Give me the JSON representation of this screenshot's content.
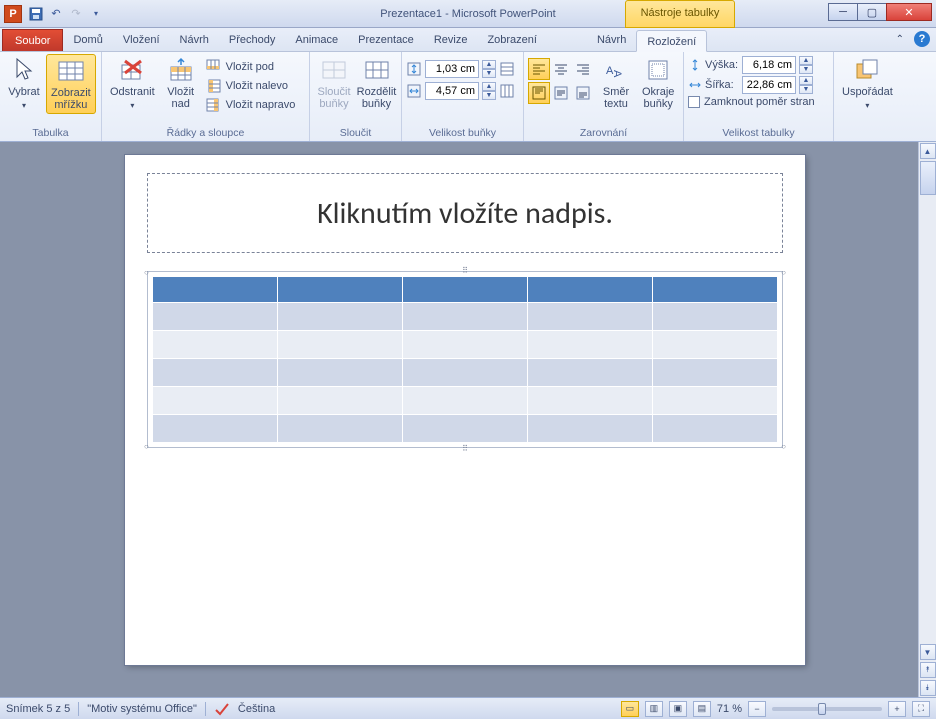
{
  "title": "Prezentace1  -  Microsoft PowerPoint",
  "context_tab": "Nástroje tabulky",
  "file_tab": "Soubor",
  "tabs": [
    "Domů",
    "Vložení",
    "Návrh",
    "Přechody",
    "Animace",
    "Prezentace",
    "Revize",
    "Zobrazení",
    "Návrh",
    "Rozložení"
  ],
  "active_tab_index": 9,
  "ribbon": {
    "tabulka": {
      "label": "Tabulka",
      "vybrat": "Vybrat",
      "mrizku": "Zobrazit\nmřížku"
    },
    "radky": {
      "label": "Řádky a sloupce",
      "odstranit": "Odstranit",
      "vlozit_nad": "Vložit\nnad",
      "pod": "Vložit pod",
      "nalevo": "Vložit nalevo",
      "napravo": "Vložit napravo"
    },
    "sloucit": {
      "label": "Sloučit",
      "sloucit": "Sloučit\nbuňky",
      "rozdelit": "Rozdělit\nbuňky"
    },
    "velbunky": {
      "label": "Velikost buňky",
      "h": "1,03 cm",
      "w": "4,57 cm"
    },
    "zarovnani": {
      "label": "Zarovnání",
      "smer": "Směr\ntextu",
      "okraje": "Okraje\nbuňky"
    },
    "veltab": {
      "label": "Velikost tabulky",
      "vyska_l": "Výška:",
      "vyska": "6,18 cm",
      "sirka_l": "Šířka:",
      "sirka": "22,86 cm",
      "lock": "Zamknout poměr stran"
    },
    "usporadat": {
      "label": "",
      "btn": "Uspořádat"
    }
  },
  "slide": {
    "title_placeholder": "Kliknutím vložíte nadpis."
  },
  "status": {
    "slidenum": "Snímek 5 z 5",
    "theme": "\"Motiv systému Office\"",
    "lang": "Čeština",
    "zoom": "71 %"
  }
}
